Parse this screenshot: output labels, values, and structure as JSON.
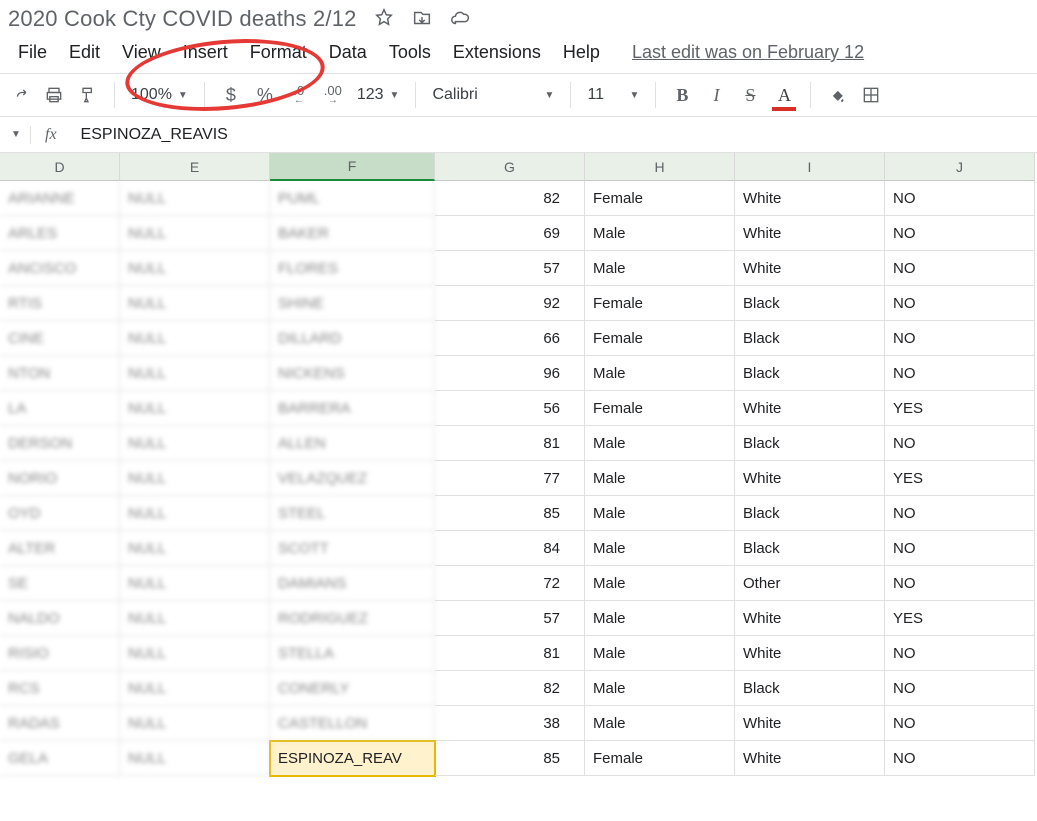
{
  "doc_title": "2020 Cook Cty COVID deaths 2/12",
  "menu": [
    "File",
    "Edit",
    "View",
    "Insert",
    "Format",
    "Data",
    "Tools",
    "Extensions",
    "Help"
  ],
  "last_edit": "Last edit was on February 12",
  "toolbar": {
    "zoom": "100%",
    "currency": "$",
    "percent": "%",
    "dec_dec": ".0",
    "dec_inc": ".00",
    "num_fmt": "123",
    "font": "Calibri",
    "size": "11",
    "bold": "B",
    "italic": "I",
    "strike": "S",
    "color": "A"
  },
  "formula": {
    "fx": "fx",
    "value": "ESPINOZA_REAVIS"
  },
  "columns": [
    "D",
    "E",
    "F",
    "G",
    "H",
    "I",
    "J"
  ],
  "selected_col_index": 2,
  "selected_row_index": 16,
  "rows": [
    {
      "d": "ARIANNE",
      "e": "NULL",
      "f": "PUML",
      "g": 82,
      "h": "Female",
      "i": "White",
      "j": "NO"
    },
    {
      "d": "ARLES",
      "e": "NULL",
      "f": "BAKER",
      "g": 69,
      "h": "Male",
      "i": "White",
      "j": "NO"
    },
    {
      "d": "ANCISCO",
      "e": "NULL",
      "f": "FLORES",
      "g": 57,
      "h": "Male",
      "i": "White",
      "j": "NO"
    },
    {
      "d": "RTIS",
      "e": "NULL",
      "f": "SHINE",
      "g": 92,
      "h": "Female",
      "i": "Black",
      "j": "NO"
    },
    {
      "d": "CINE",
      "e": "NULL",
      "f": "DILLARD",
      "g": 66,
      "h": "Female",
      "i": "Black",
      "j": "NO"
    },
    {
      "d": "NTON",
      "e": "NULL",
      "f": "NICKENS",
      "g": 96,
      "h": "Male",
      "i": "Black",
      "j": "NO"
    },
    {
      "d": "LA",
      "e": "NULL",
      "f": "BARRERA",
      "g": 56,
      "h": "Female",
      "i": "White",
      "j": "YES"
    },
    {
      "d": "DERSON",
      "e": "NULL",
      "f": "ALLEN",
      "g": 81,
      "h": "Male",
      "i": "Black",
      "j": "NO"
    },
    {
      "d": "NORIO",
      "e": "NULL",
      "f": "VELAZQUEZ",
      "g": 77,
      "h": "Male",
      "i": "White",
      "j": "YES"
    },
    {
      "d": "OYD",
      "e": "NULL",
      "f": "STEEL",
      "g": 85,
      "h": "Male",
      "i": "Black",
      "j": "NO"
    },
    {
      "d": "ALTER",
      "e": "NULL",
      "f": "SCOTT",
      "g": 84,
      "h": "Male",
      "i": "Black",
      "j": "NO"
    },
    {
      "d": "SE",
      "e": "NULL",
      "f": "DAMIANS",
      "g": 72,
      "h": "Male",
      "i": "Other",
      "j": "NO"
    },
    {
      "d": "NALDO",
      "e": "NULL",
      "f": "RODRIGUEZ",
      "g": 57,
      "h": "Male",
      "i": "White",
      "j": "YES"
    },
    {
      "d": "RISIO",
      "e": "NULL",
      "f": "STELLA",
      "g": 81,
      "h": "Male",
      "i": "White",
      "j": "NO"
    },
    {
      "d": "RCS",
      "e": "NULL",
      "f": "CONERLY",
      "g": 82,
      "h": "Male",
      "i": "Black",
      "j": "NO"
    },
    {
      "d": "RADAS",
      "e": "NULL",
      "f": "CASTELLON",
      "g": 38,
      "h": "Male",
      "i": "White",
      "j": "NO"
    },
    {
      "d": "GELA",
      "e": "NULL",
      "f": "ESPINOZA_REAV",
      "g": 85,
      "h": "Female",
      "i": "White",
      "j": "NO"
    }
  ]
}
